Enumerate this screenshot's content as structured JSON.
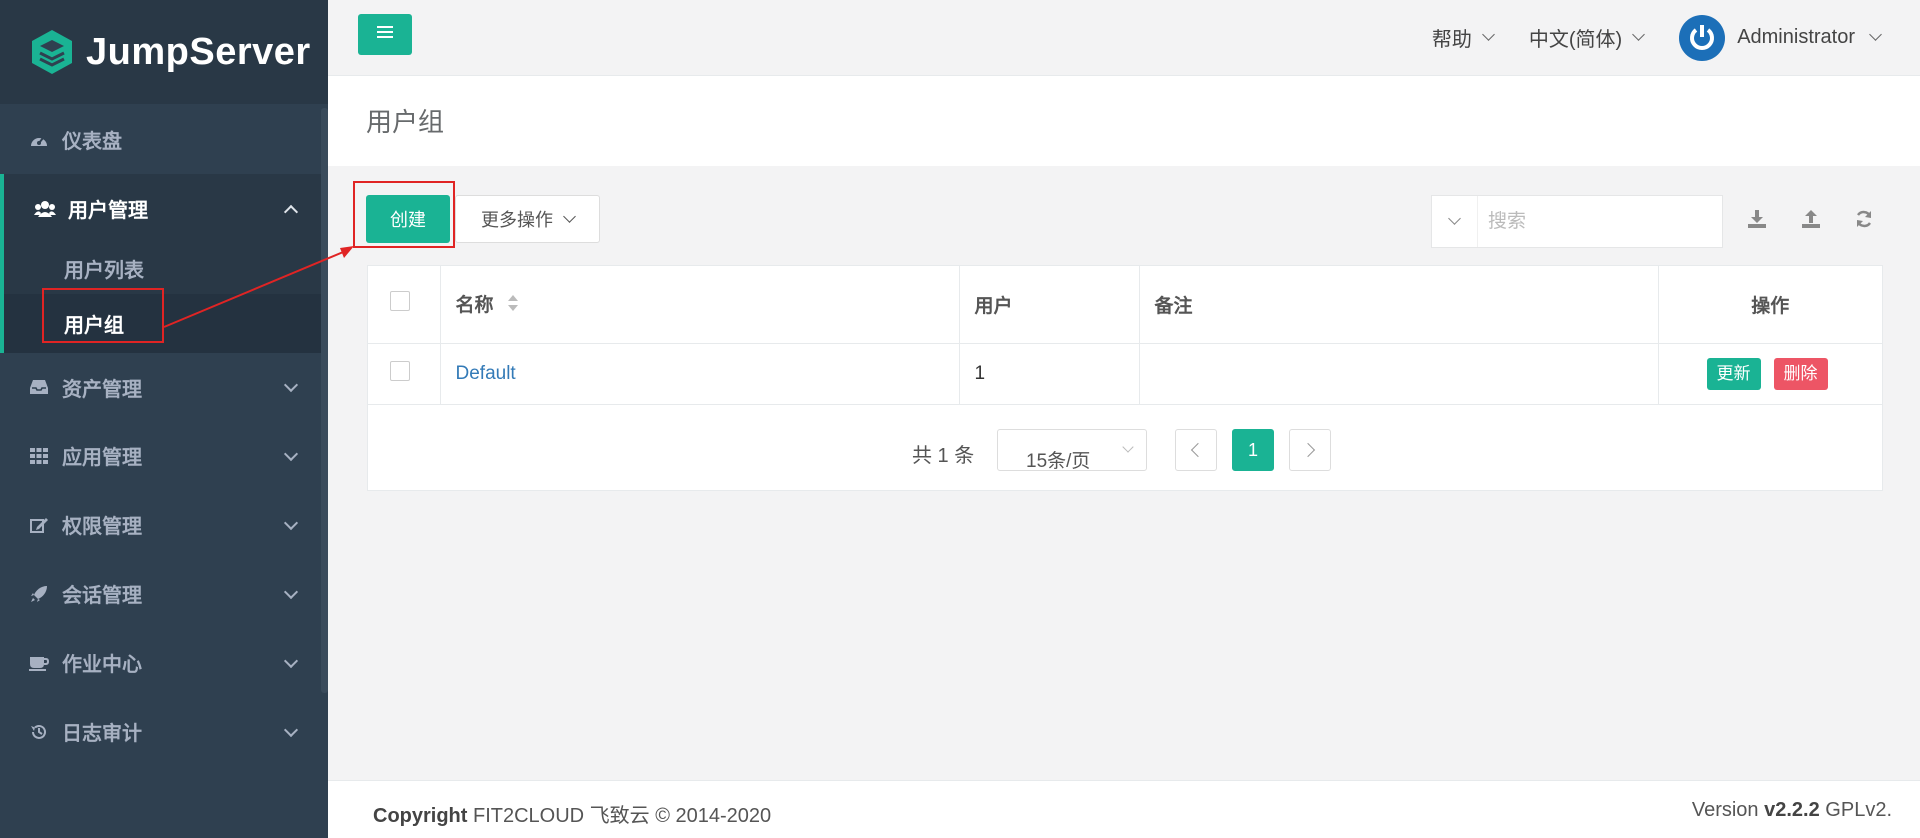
{
  "app": {
    "logo_text": "JumpServer"
  },
  "sidebar": {
    "items": [
      {
        "label": "仪表盘",
        "icon": "dashboard-icon"
      },
      {
        "label": "用户管理",
        "icon": "users-icon",
        "expanded": true,
        "children": [
          {
            "label": "用户列表"
          },
          {
            "label": "用户组",
            "active": true
          }
        ]
      },
      {
        "label": "资产管理",
        "icon": "inbox-icon"
      },
      {
        "label": "应用管理",
        "icon": "grid-icon"
      },
      {
        "label": "权限管理",
        "icon": "edit-icon"
      },
      {
        "label": "会话管理",
        "icon": "rocket-icon"
      },
      {
        "label": "作业中心",
        "icon": "coffee-icon"
      },
      {
        "label": "日志审计",
        "icon": "history-icon"
      }
    ]
  },
  "header": {
    "help": "帮助",
    "language": "中文(简体)",
    "user": "Administrator"
  },
  "page": {
    "title": "用户组"
  },
  "toolbar": {
    "create": "创建",
    "more_actions": "更多操作",
    "search_placeholder": "搜索"
  },
  "table": {
    "columns": [
      "名称",
      "用户",
      "备注",
      "操作"
    ],
    "rows": [
      {
        "name": "Default",
        "users": "1",
        "comment": "",
        "update": "更新",
        "delete": "删除"
      }
    ]
  },
  "pagination": {
    "total": "共 1 条",
    "per_page": "15条/页",
    "current_page": "1"
  },
  "footer": {
    "copyright_label": "Copyright",
    "copyright_text": "FIT2CLOUD 飞致云 © 2014-2020",
    "version_label": "Version",
    "version": "v2.2.2",
    "license": "GPLv2."
  },
  "colors": {
    "primary": "#1ab394",
    "danger": "#ed5565",
    "sidebar": "#2f4050",
    "annotation": "#e02424"
  }
}
